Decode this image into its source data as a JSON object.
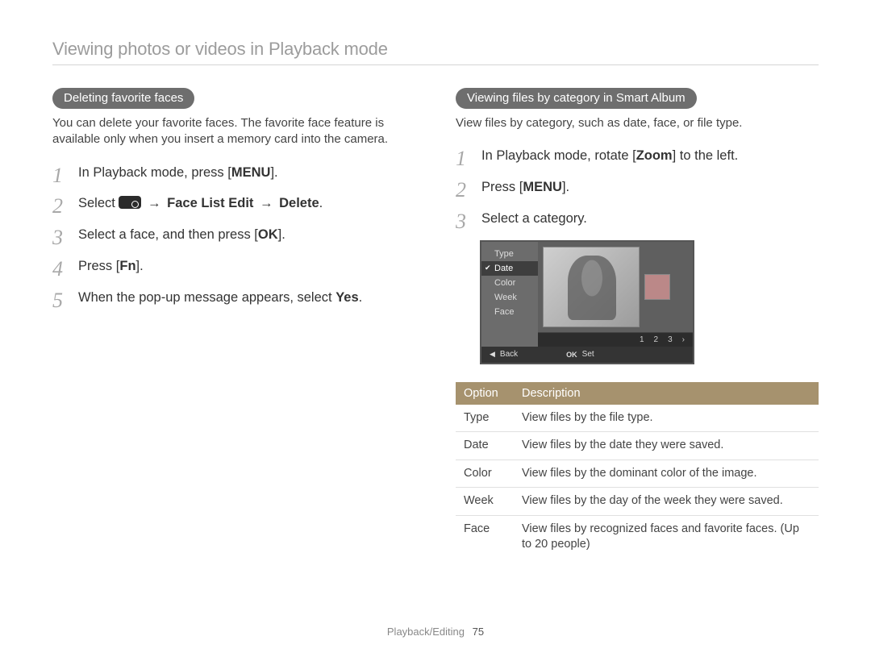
{
  "page_title": "Viewing photos or videos in Playback mode",
  "left": {
    "pill": "Deleting favorite faces",
    "intro": "You can delete your favorite faces. The favorite face feature is available only when you insert a memory card into the camera.",
    "steps": {
      "s1_a": "In Playback mode, press [",
      "s1_btn": "MENU",
      "s1_b": "].",
      "s2_a": "Select ",
      "s2_arrow": "→",
      "s2_b1": "Face List Edit",
      "s2_b2": "Delete",
      "s2_c": ".",
      "s3_a": "Select a face, and then press [",
      "s3_btn": "OK",
      "s3_b": "].",
      "s4_a": "Press [",
      "s4_btn": "Fn",
      "s4_b": "].",
      "s5_a": "When the pop-up message appears, select ",
      "s5_b": "Yes",
      "s5_c": "."
    }
  },
  "right": {
    "pill": "Viewing files by category in Smart Album",
    "intro": "View files by category, such as date, face, or file type.",
    "steps": {
      "s1_a": "In Playback mode, rotate [",
      "s1_btn": "Zoom",
      "s1_b": "] to the left.",
      "s2_a": "Press [",
      "s2_btn": "MENU",
      "s2_b": "].",
      "s3": "Select a category."
    },
    "lcd": {
      "menu": [
        "Type",
        "Date",
        "Color",
        "Week",
        "Face"
      ],
      "selected_index": 1,
      "pager": [
        "1",
        "2",
        "3",
        "›"
      ],
      "foot_back_icon": "◀",
      "foot_back": "Back",
      "foot_set_icon": "OK",
      "foot_set": "Set"
    },
    "table": {
      "head_option": "Option",
      "head_desc": "Description",
      "rows": [
        {
          "opt": "Type",
          "desc": "View files by the file type."
        },
        {
          "opt": "Date",
          "desc": "View files by the date they were saved."
        },
        {
          "opt": "Color",
          "desc": "View files by the dominant color of the image."
        },
        {
          "opt": "Week",
          "desc": "View files by the day of the week they were saved."
        },
        {
          "opt": "Face",
          "desc": "View files by recognized faces and favorite faces. (Up to 20 people)"
        }
      ]
    }
  },
  "footer": {
    "section": "Playback/Editing",
    "page": "75"
  }
}
